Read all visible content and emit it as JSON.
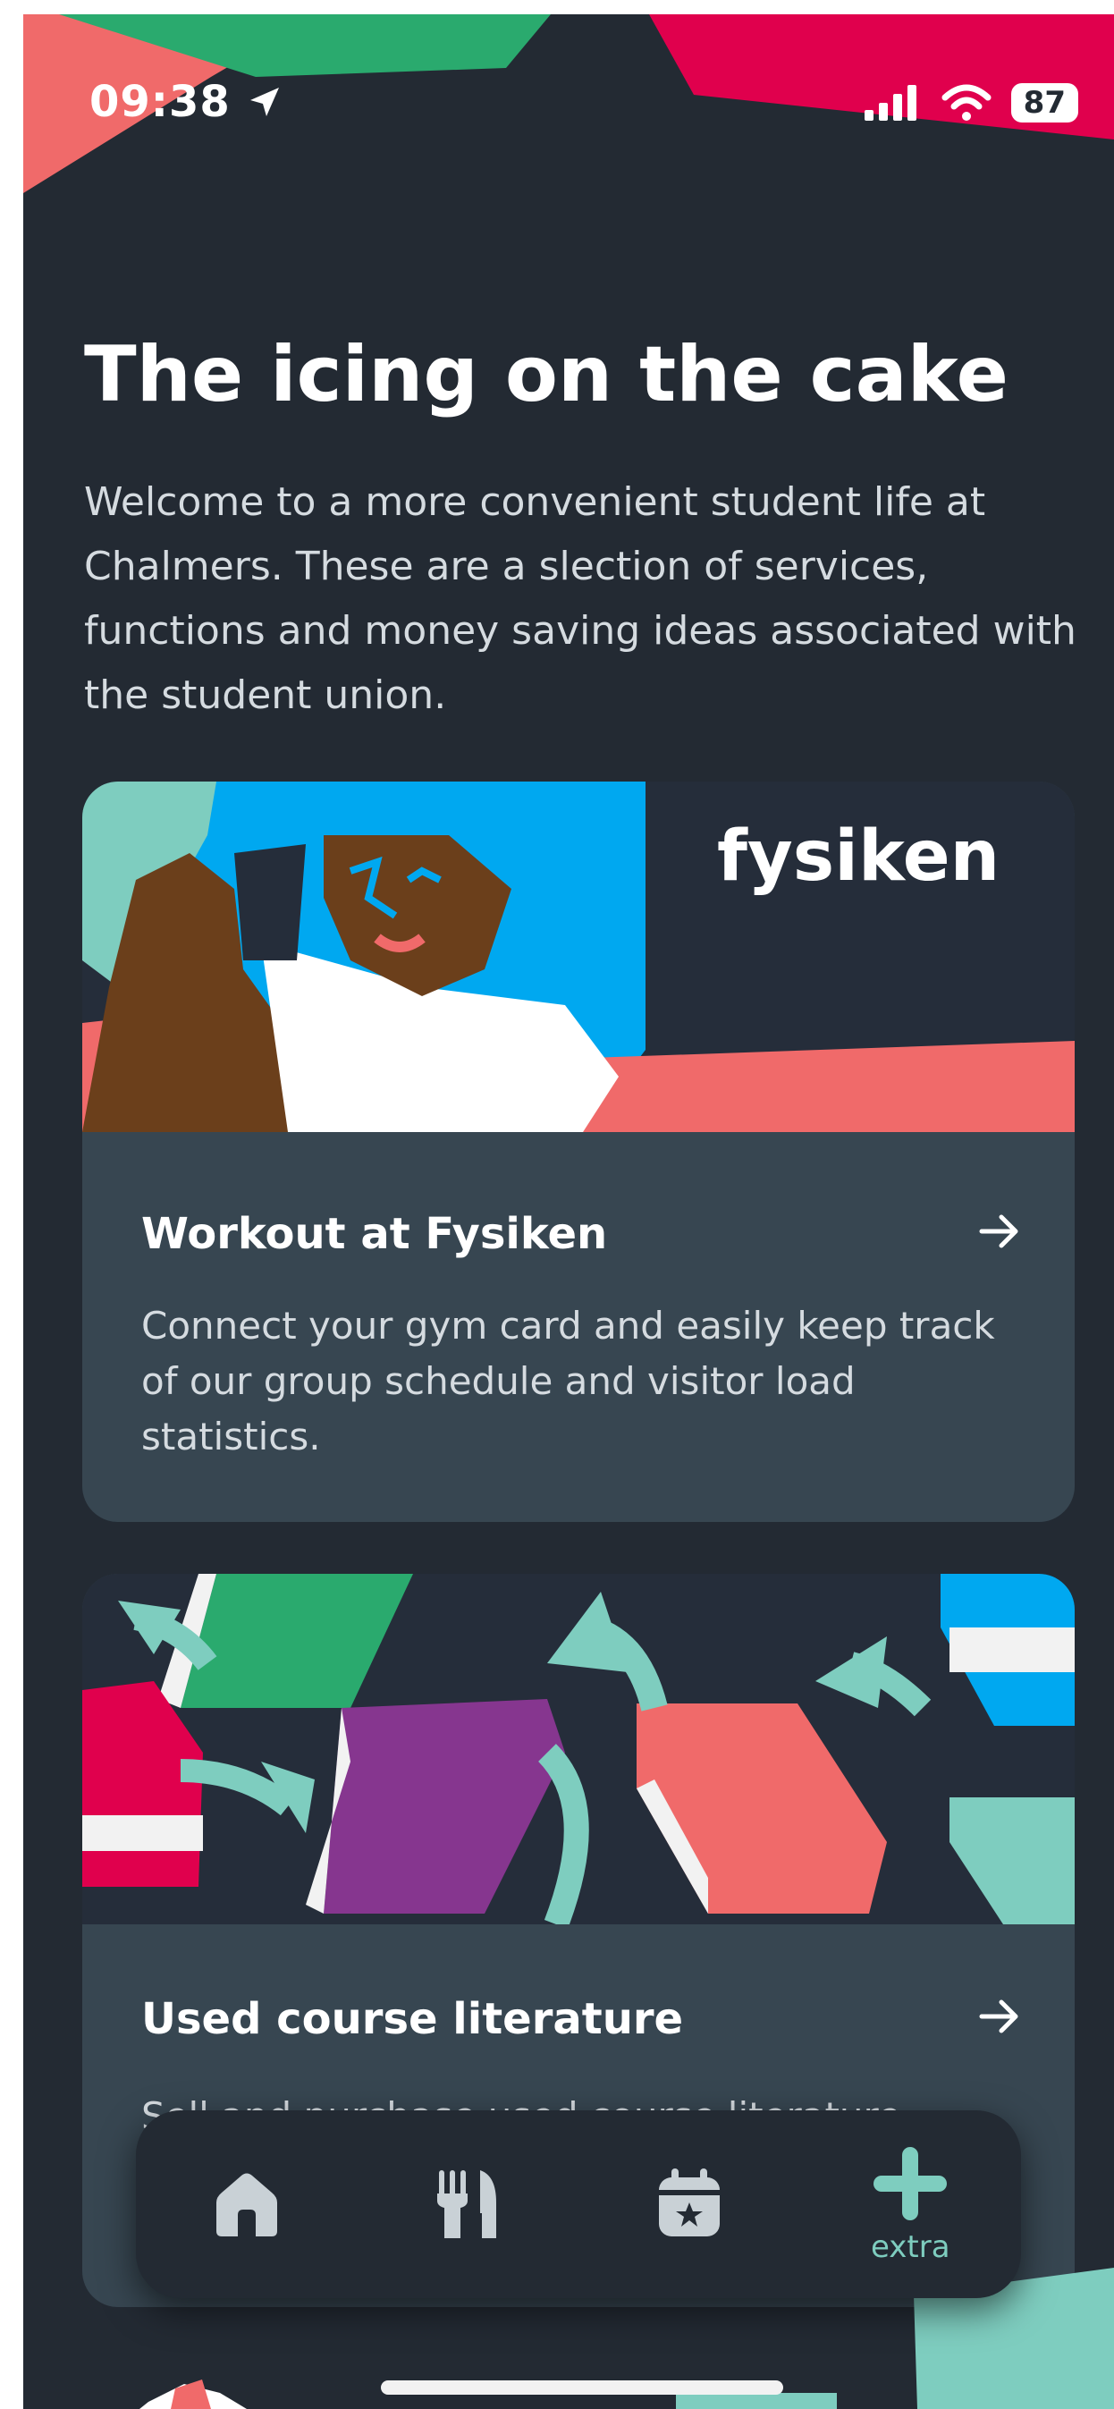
{
  "status_bar": {
    "time": "09:38",
    "battery": "87"
  },
  "page": {
    "title": "The icing on the cake",
    "intro": "Welcome to a more convenient student life at Chalmers. These are a slection of services, functions and money saving ideas associated with the student union."
  },
  "cards": [
    {
      "brand": "fysiken",
      "title": "Workout at Fysiken",
      "description": "Connect your gym card and easily keep track of our group schedule and visitor load statistics."
    },
    {
      "title": "Used course literature",
      "description": "Sell and purchase used course literature"
    }
  ],
  "nav": {
    "items": [
      {
        "icon": "home-icon"
      },
      {
        "icon": "fork-knife-icon"
      },
      {
        "icon": "calendar-star-icon"
      },
      {
        "icon": "plus-icon",
        "label": "extra",
        "active": true
      }
    ]
  },
  "colors": {
    "background": "#232a33",
    "card": "#374651",
    "accent_teal": "#7ecdbf",
    "accent_green": "#2aaa6e",
    "accent_red": "#e0004d",
    "accent_salmon": "#f06a6a",
    "accent_blue": "#00a8f0",
    "accent_purple": "#86368f"
  }
}
